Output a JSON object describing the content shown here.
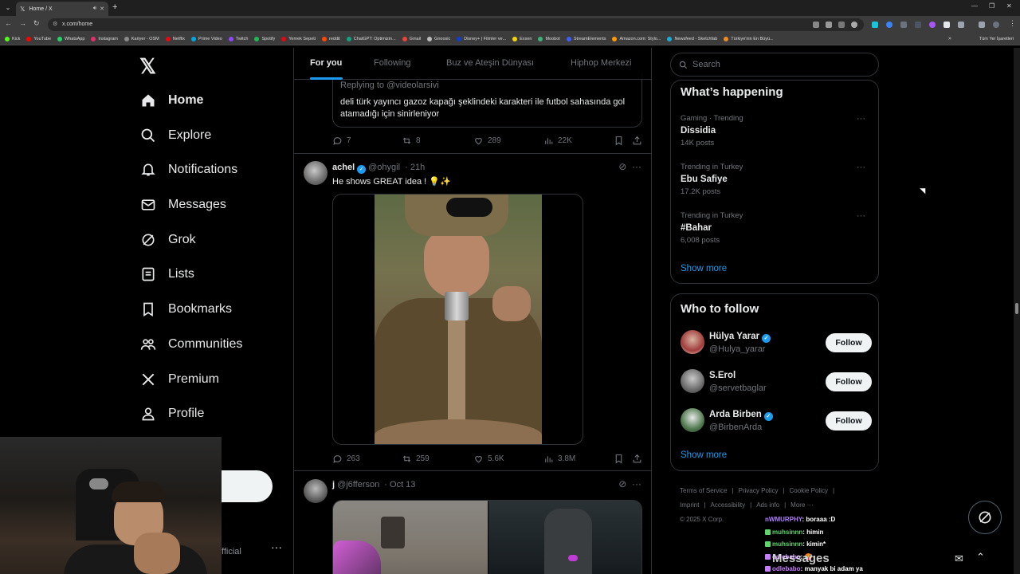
{
  "browser": {
    "tab_title": "Home / X",
    "url": "x.com/home",
    "bookmarks": [
      "Kick",
      "YouTube",
      "WhatsApp",
      "Instagram",
      "Kariyer - OSM",
      "Netflix",
      "Prime Video",
      "Twitch",
      "Spotify",
      "Yemek Sepeti",
      "reddit",
      "ChatGPT: Optimizin...",
      "Gmail",
      "Gnoosic",
      "Disney+ | Filmler ve...",
      "Exxen",
      "Moobot",
      "StreamElements",
      "Amazon.com: Stylo...",
      "Newsfeed - Sketchfab",
      "Türkiye'nin En Büyü..."
    ],
    "bookmark_colors": [
      "#53fc18",
      "#ff0000",
      "#25d366",
      "#e1306c",
      "#8a8a8a",
      "#e50914",
      "#00a8e1",
      "#9146ff",
      "#1db954",
      "#e30613",
      "#ff4500",
      "#10a37f",
      "#ea4335",
      "#bbbbbb",
      "#113ccf",
      "#f6d600",
      "#3db37c",
      "#3f5cff",
      "#ff9900",
      "#1caad9",
      "#f08a24"
    ],
    "all_bookmarks": "Tüm Yer İşaretleri"
  },
  "nav": {
    "items": [
      {
        "label": "Home",
        "icon": "home-icon"
      },
      {
        "label": "Explore",
        "icon": "search-icon"
      },
      {
        "label": "Notifications",
        "icon": "bell-icon"
      },
      {
        "label": "Messages",
        "icon": "envelope-icon"
      },
      {
        "label": "Grok",
        "icon": "grok-icon"
      },
      {
        "label": "Lists",
        "icon": "list-icon"
      },
      {
        "label": "Bookmarks",
        "icon": "bookmark-icon"
      },
      {
        "label": "Communities",
        "icon": "people-icon"
      },
      {
        "label": "Premium",
        "icon": "x-icon"
      },
      {
        "label": "Profile",
        "icon": "person-icon"
      }
    ],
    "account_suffix": "fficial"
  },
  "timeline": {
    "tabs": [
      "For you",
      "Following",
      "Buz ve Ateşin Dünyası",
      "Hiphop Merkezi"
    ],
    "post1": {
      "replying": "Replying to @videolarsivi",
      "quote_text": "deli türk yayıncı gazoz kapağı şeklindeki karakteri ile futbol sahasında gol atamadığı için sinirleniyor",
      "replies": "7",
      "reposts": "8",
      "likes": "289",
      "views": "22K"
    },
    "post2": {
      "name": "achel",
      "handle": "@ohygil",
      "time": "· 21h",
      "text": "He shows GREAT idea ! 💡✨",
      "replies": "263",
      "reposts": "259",
      "likes": "5.6K",
      "views": "3.8M"
    },
    "post3": {
      "name": "j",
      "handle": "@j6fferson",
      "time": "· Oct 13"
    }
  },
  "sidebar": {
    "search_placeholder": "Search",
    "trends_title": "What’s happening",
    "trends": [
      {
        "meta": "Gaming · Trending",
        "name": "Dissidia",
        "posts": "14K posts"
      },
      {
        "meta": "Trending in Turkey",
        "name": "Ebu Safiye",
        "posts": "17.2K posts"
      },
      {
        "meta": "Trending in Turkey",
        "name": "#Bahar",
        "posts": "6,008 posts"
      }
    ],
    "show_more": "Show more",
    "wtf_title": "Who to follow",
    "follow_label": "Follow",
    "wtf": [
      {
        "name": "Hülya Yarar",
        "handle": "@Hulya_yarar",
        "verified": true
      },
      {
        "name": "S.Erol",
        "handle": "@servetbaglar",
        "verified": false
      },
      {
        "name": "Arda Birben",
        "handle": "@BirbenArda",
        "verified": true
      }
    ],
    "footer": [
      "Terms of Service",
      "|",
      "Privacy Policy",
      "|",
      "Cookie Policy",
      "|",
      "Imprint",
      "|",
      "Accessibility",
      "|",
      "Ads info",
      "|",
      "More ···",
      "© 2025 X Corp."
    ]
  },
  "chat": [
    {
      "user": "nWMURPHY",
      "msg": ": boraaa :D",
      "color": "#b07cff"
    },
    {
      "user": "muhsinnn",
      "msg": ": himin",
      "color": "#5bd66b"
    },
    {
      "user": "muhsinnn",
      "msg": ": kimin*",
      "color": "#5bd66b"
    },
    {
      "user": "odlebabo",
      "msg": ": 🥵",
      "color": "#c77dff"
    },
    {
      "user": "odlebabo",
      "msg": ": manyak bi adam ya",
      "color": "#c77dff"
    }
  ],
  "messages_drawer": {
    "title": "Messages"
  },
  "colors": {
    "accent": "#1d9bf0",
    "border": "#2f3336",
    "muted": "#71767b"
  }
}
